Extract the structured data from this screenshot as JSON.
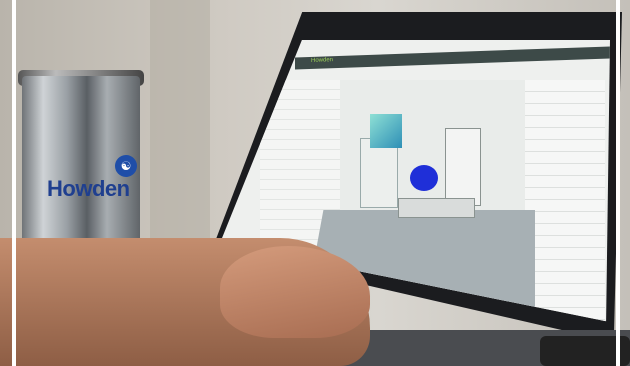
{
  "cup": {
    "logo_text": "Howden",
    "logo_mark": "☯"
  },
  "software": {
    "brand": "Howden",
    "title": ""
  }
}
